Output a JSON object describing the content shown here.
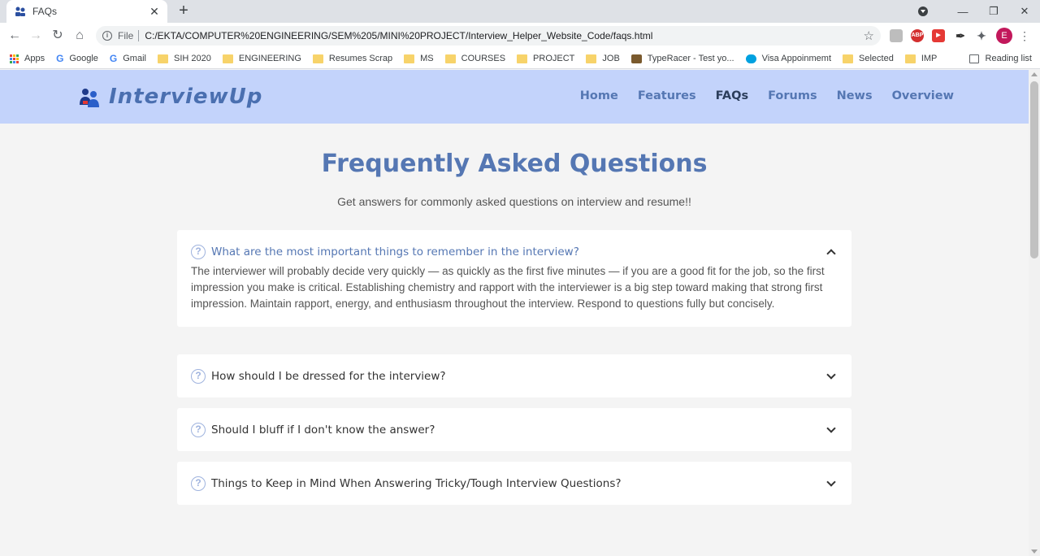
{
  "browser": {
    "tab_title": "FAQs",
    "url_scheme": "File",
    "url": "C:/EKTA/COMPUTER%20ENGINEERING/SEM%205/MINI%20PROJECT/Interview_Helper_Website_Code/faqs.html",
    "profile_initial": "E",
    "extensions": [
      "ABP"
    ],
    "bookmarks": [
      {
        "label": "Apps",
        "icon": "apps-grid-icon"
      },
      {
        "label": "Google",
        "icon": "google-icon"
      },
      {
        "label": "Gmail",
        "icon": "google-icon"
      },
      {
        "label": "SIH 2020",
        "icon": "folder-icon"
      },
      {
        "label": "ENGINEERING",
        "icon": "folder-icon"
      },
      {
        "label": "Resumes Scrap",
        "icon": "folder-icon"
      },
      {
        "label": "MS",
        "icon": "folder-icon"
      },
      {
        "label": "COURSES",
        "icon": "folder-icon"
      },
      {
        "label": "PROJECT",
        "icon": "folder-icon"
      },
      {
        "label": "JOB",
        "icon": "folder-icon"
      },
      {
        "label": "TypeRacer - Test yo...",
        "icon": "typeracer-icon"
      },
      {
        "label": "Visa Appoinmemt",
        "icon": "salesforce-icon"
      },
      {
        "label": "Selected",
        "icon": "folder-icon"
      },
      {
        "label": "IMP",
        "icon": "folder-icon"
      }
    ],
    "reading_list": "Reading list"
  },
  "site": {
    "brand": "InterviewUp",
    "nav": [
      "Home",
      "Features",
      "FAQs",
      "Forums",
      "News",
      "Overview"
    ],
    "active_nav": "FAQs",
    "colors": {
      "header_bg": "#c3d3fb",
      "accent": "#5577b3"
    }
  },
  "faq": {
    "title": "Frequently Asked Questions",
    "subtitle": "Get answers for commonly asked questions on interview and resume!!",
    "items": [
      {
        "question": "What are the most important things to remember in the interview?",
        "answer": "The interviewer will probably decide very quickly — as quickly as the first five minutes — if you are a good fit for the job, so the first impression you make is critical. Establishing chemistry and rapport with the interviewer is a big step toward making that strong first impression. Maintain rapport, energy, and enthusiasm throughout the interview. Respond to questions fully but concisely.",
        "expanded": true
      },
      {
        "question": "How should I be dressed for the interview?",
        "expanded": false
      },
      {
        "question": "Should I bluff if I don't know the answer?",
        "expanded": false
      },
      {
        "question": "Things to Keep in Mind When Answering Tricky/Tough Interview Questions?",
        "expanded": false
      }
    ]
  }
}
